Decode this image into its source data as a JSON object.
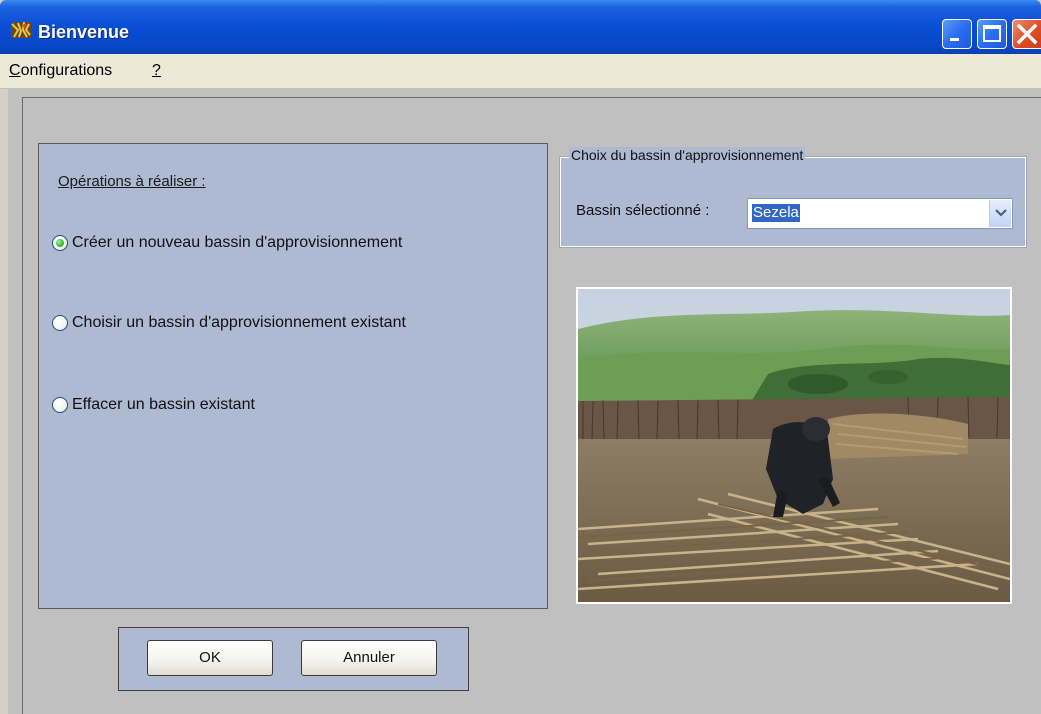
{
  "window": {
    "title": "Bienvenue",
    "icon": "app-icon"
  },
  "menu": {
    "items": [
      {
        "mnemonic": "C",
        "rest": "onfigurations"
      },
      {
        "mnemonic": "?",
        "rest": ""
      }
    ]
  },
  "operations": {
    "title": "Opérations à réaliser :",
    "options": [
      {
        "label": "Créer un nouveau bassin d'approvisionnement",
        "checked": true
      },
      {
        "label": "Choisir un bassin d'approvisionnement existant",
        "checked": false
      },
      {
        "label": "Effacer un bassin existant",
        "checked": false
      }
    ]
  },
  "buttons": {
    "ok": "OK",
    "cancel": "Annuler"
  },
  "basin_choice": {
    "legend": "Choix du bassin d'approvisionnement",
    "label": "Bassin sélectionné :",
    "selected": "Sezela"
  },
  "colors": {
    "panel": "#adbad2",
    "titlebar": "#0848c8",
    "selection": "#3168c5",
    "radio_checked": "#3fbf3a"
  }
}
